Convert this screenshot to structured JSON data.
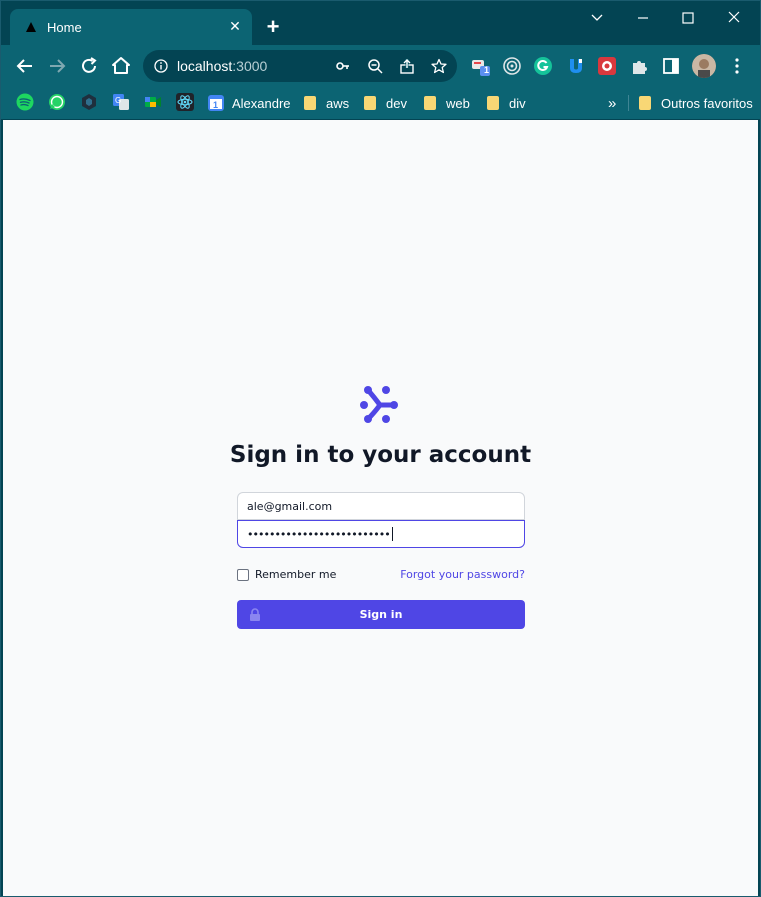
{
  "browser": {
    "tab_title": "Home",
    "url_host": "localhost",
    "url_port": ":3000",
    "extension_badge": "1"
  },
  "bookmarks": [
    {
      "label": "Alexandre",
      "icon": "calendar-icon"
    },
    {
      "label": "aws",
      "icon": "folder-icon"
    },
    {
      "label": "dev",
      "icon": "folder-icon"
    },
    {
      "label": "web",
      "icon": "folder-icon"
    },
    {
      "label": "div",
      "icon": "folder-icon"
    }
  ],
  "bookmarks_more": "»",
  "other_bookmarks": "Outros favoritos",
  "signin": {
    "heading": "Sign in to your account",
    "email_value": "ale@gmail.com",
    "password_value": "••••••••••••••••••••••••••",
    "remember_label": "Remember me",
    "forgot_label": "Forgot your password?",
    "submit_label": "Sign in"
  },
  "colors": {
    "brand": "#4f46e5",
    "browser_frame": "#034453",
    "toolbar": "#0c6473",
    "page_bg": "#f9fafb"
  }
}
